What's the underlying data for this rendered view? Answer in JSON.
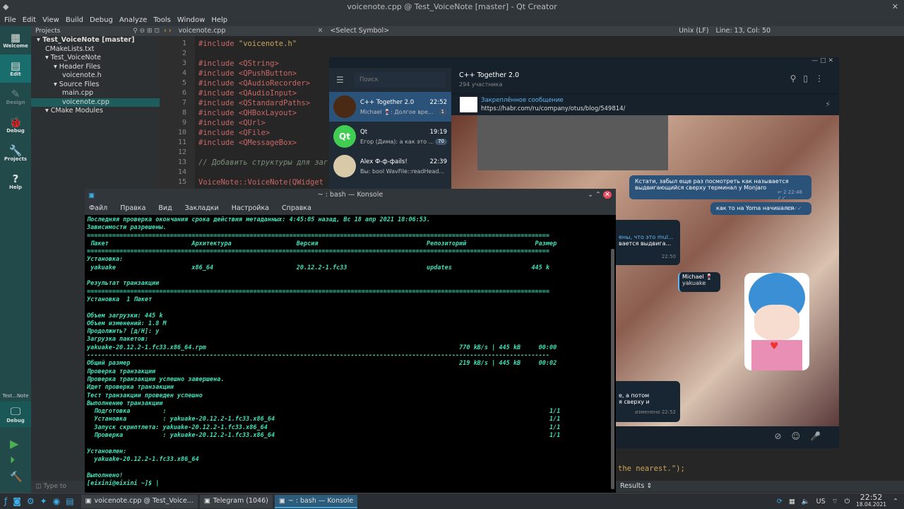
{
  "window_title": "voicenote.cpp @ Test_VoiceNote [master] - Qt Creator",
  "qt_menu": [
    "File",
    "Edit",
    "View",
    "Build",
    "Debug",
    "Analyze",
    "Tools",
    "Window",
    "Help"
  ],
  "modes": [
    {
      "label": "Welcome",
      "icon": "grid-icon"
    },
    {
      "label": "Edit",
      "icon": "document-icon"
    },
    {
      "label": "Design",
      "icon": "pencil-icon"
    },
    {
      "label": "Debug",
      "icon": "bug-icon"
    },
    {
      "label": "Projects",
      "icon": "wrench-icon"
    },
    {
      "label": "Help",
      "icon": "question-icon"
    }
  ],
  "session_label": "Test...Note",
  "debug_label": "Debug",
  "projects_header": "Projects",
  "tree": [
    {
      "t": "Test_VoiceNote [master]",
      "d": 0,
      "bold": true
    },
    {
      "t": "CMakeLists.txt",
      "d": 1
    },
    {
      "t": "Test_VoiceNote",
      "d": 1
    },
    {
      "t": "Header Files",
      "d": 2
    },
    {
      "t": "voicenote.h",
      "d": 3
    },
    {
      "t": "Source Files",
      "d": 2
    },
    {
      "t": "main.cpp",
      "d": 3
    },
    {
      "t": "voicenote.cpp",
      "d": 3,
      "sel": true
    },
    {
      "t": "CMake Modules",
      "d": 1
    }
  ],
  "editor": {
    "file": "voicenote.cpp",
    "symbol": "<Select Symbol>",
    "encoding": "Unix (LF)",
    "position": "Line: 13, Col: 50"
  },
  "code_lines": [
    {
      "n": "1",
      "html": "<span class='kw'>#include</span> <span class='str'>\"voicenote.h\"</span>"
    },
    {
      "n": "2",
      "html": ""
    },
    {
      "n": "3",
      "html": "<span class='kw'>#include</span> <span class='kw'>&lt;QString&gt;</span>"
    },
    {
      "n": "4",
      "html": "<span class='kw'>#include</span> <span class='kw'>&lt;QPushButton&gt;</span>"
    },
    {
      "n": "5",
      "html": "<span class='kw'>#include</span> <span class='kw'>&lt;QAudioRecorder&gt;</span>"
    },
    {
      "n": "6",
      "html": "<span class='kw'>#include</span> <span class='kw'>&lt;QAudioInput&gt;</span>"
    },
    {
      "n": "7",
      "html": "<span class='kw'>#include</span> <span class='kw'>&lt;QStandardPaths&gt;</span>"
    },
    {
      "n": "8",
      "html": "<span class='kw'>#include</span> <span class='kw'>&lt;QHBoxLayout&gt;</span>"
    },
    {
      "n": "9",
      "html": "<span class='kw'>#include</span> <span class='kw'>&lt;QUrl&gt;</span>"
    },
    {
      "n": "10",
      "html": "<span class='kw'>#include</span> <span class='kw'>&lt;QFile&gt;</span>"
    },
    {
      "n": "11",
      "html": "<span class='kw'>#include</span> <span class='kw'>&lt;QMessageBox&gt;</span>"
    },
    {
      "n": "12",
      "html": ""
    },
    {
      "n": "13",
      "html": "<span class='cmt'>// Добавить структуры для заг</span>"
    },
    {
      "n": "14",
      "html": ""
    },
    {
      "n": "15",
      "html": "<span class='kw'>VoiceNote::VoiceNote(QWidget</span>"
    }
  ],
  "code_tail": "the nearest.\");",
  "results_label": "Results",
  "telegram": {
    "search_placeholder": "Поиск",
    "chat_title": "C++ Together 2.0",
    "chat_sub": "294 участника",
    "pinned_title": "Закреплённое сообщение",
    "pinned_link": "https://habr.com/ru/company/otus/blog/549814/",
    "chats": [
      {
        "name": "C++ Together 2.0",
        "time": "22:52",
        "msg": "Michael 🍷: Долгое вре...",
        "badge": "1",
        "color": "#4a2a14",
        "sel": true
      },
      {
        "name": "Qt",
        "time": "19:19",
        "msg": "Егор (Дима): а как это ...",
        "badge": "70",
        "color": "#41cd52"
      },
      {
        "name": "Alex Ф-ф-фails!",
        "time": "22:39",
        "msg": "Вы: bool WavFile::readHead...",
        "badge": "",
        "color": "#d8c9a8"
      }
    ],
    "msg1": "Кстати, забыл еще раз посмотреть как называется",
    "msg1b": "выдвигающийся сверху терминал у Monjaro",
    "msg1_time": "22:48",
    "msg1_reply": "2",
    "msg2": "как то на Yoma начинался",
    "msg2_time": "22:48",
    "left1a": "ены, что это mul...",
    "left1b": "вается выдвига...",
    "left1_time": "22:50",
    "reply_author": "Michael 🍷",
    "reply_text": "yakuake",
    "left2a": "е, а потом",
    "left2b": "я сверху и",
    "left2_time": "изменено 22:52"
  },
  "konsole": {
    "title": "~ : bash — Konsole",
    "menu": [
      "Файл",
      "Правка",
      "Вид",
      "Закладки",
      "Настройка",
      "Справка"
    ],
    "lines": [
      "Последняя проверка окончания срока действия метаданных: 4:45:05 назад, Вс 18 апр 2021 18:06:53.",
      "Зависимости разрешены.",
      "================================================================================================================================",
      " Пакет                       Архитектура                  Версия                              Репозиторий                   Размер",
      "================================================================================================================================",
      "Установка:",
      " yakuake                     x86_64                       20.12.2-1.fc33                      updates                      445 k",
      "",
      "Результат транзакции",
      "================================================================================================================================",
      "Установка  1 Пакет",
      "",
      "Объем загрузки: 445 k",
      "Объем изменений: 1.8 M",
      "Продолжить? [д/Н]: y",
      "Загрузка пакетов:",
      "yakuake-20.12.2-1.fc33.x86_64.rpm                                                                      770 kB/s | 445 kB     00:00",
      "--------------------------------------------------------------------------------------------------------------------------------",
      "Общий размер                                                                                           219 kB/s | 445 kB     00:02",
      "Проверка транзакции",
      "Проверка транзакции успешно завершена.",
      "Идет проверка транзакции",
      "Тест транзакции проведен успешно",
      "Выполнение транзакции",
      "  Подготовка         :                                                                                                          1/1",
      "  Установка          : yakuake-20.12.2-1.fc33.x86_64                                                                            1/1",
      "  Запуск скриптлета: yakuake-20.12.2-1.fc33.x86_64                                                                              1/1",
      "  Проверка           : yakuake-20.12.2-1.fc33.x86_64                                                                            1/1",
      "",
      "Установлен:",
      "  yakuake-20.12.2-1.fc33.x86_64",
      "",
      "Выполнено!",
      "[eixini@eixini ~]$ |"
    ]
  },
  "taskbar": {
    "tasks": [
      {
        "label": "voicenote.cpp @ Test_Voice...",
        "icon": "qt-icon"
      },
      {
        "label": "Telegram (1046)",
        "icon": "telegram-icon"
      },
      {
        "label": "~ : bash — Konsole",
        "icon": "terminal-icon",
        "active": true
      }
    ],
    "lang": "US",
    "time": "22:52",
    "date": "18.04.2021",
    "type_to": "Type to"
  }
}
